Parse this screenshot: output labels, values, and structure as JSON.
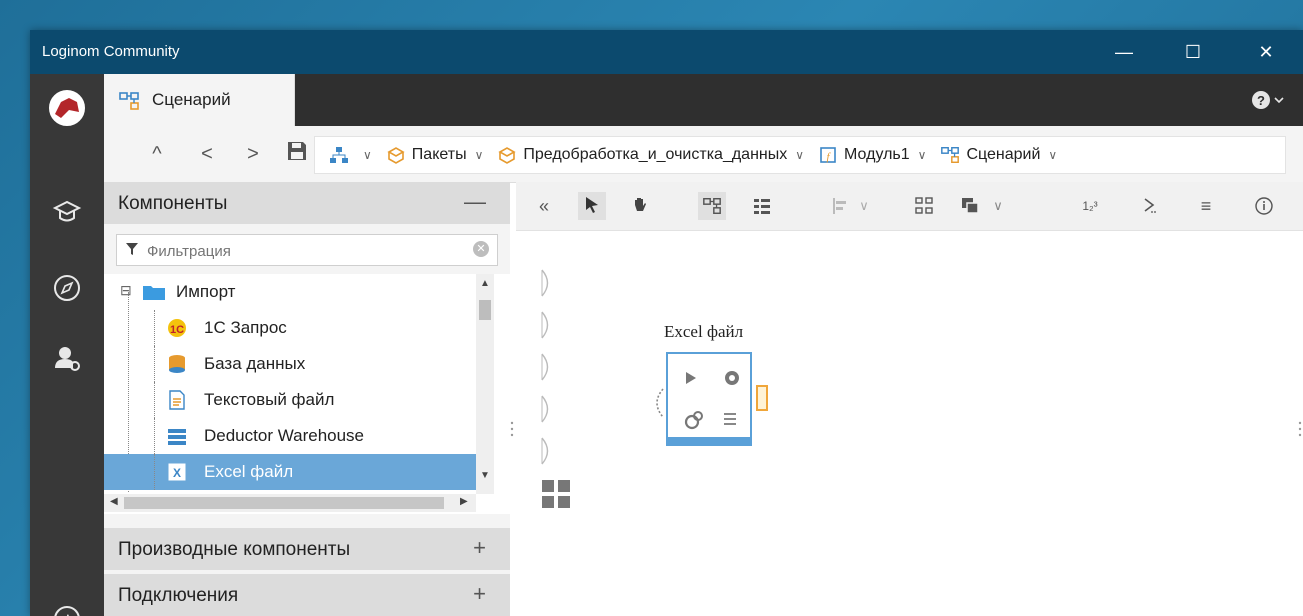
{
  "window": {
    "title": "Loginom Community",
    "controls": {
      "minimize": "—",
      "maximize": "☐",
      "close": "✕"
    }
  },
  "tabs": [
    {
      "label": "Сценарий",
      "icon": "scenario-icon",
      "active": true
    }
  ],
  "breadcrumbs": [
    {
      "label": "",
      "icon": "hierarchy-icon"
    },
    {
      "label": "Пакеты",
      "icon": "package-icon"
    },
    {
      "label": "Предобработка_и_очистка_данных",
      "icon": "package-icon"
    },
    {
      "label": "Модуль1",
      "icon": "module-icon"
    },
    {
      "label": "Сценарий",
      "icon": "scenario-icon"
    }
  ],
  "nav": {
    "up": "^",
    "back": "<",
    "forward": ">"
  },
  "components": {
    "header": "Компоненты",
    "collapse": "—",
    "filter_placeholder": "Фильтрация",
    "tree": [
      {
        "label": "Импорт",
        "icon": "folder-icon",
        "level": 0
      },
      {
        "label": "1С Запрос",
        "icon": "1c-icon",
        "level": 1
      },
      {
        "label": "База данных",
        "icon": "database-icon",
        "level": 1
      },
      {
        "label": "Текстовый файл",
        "icon": "text-file-icon",
        "level": 1
      },
      {
        "label": "Deductor Warehouse",
        "icon": "warehouse-icon",
        "level": 1
      },
      {
        "label": "Excel файл",
        "icon": "excel-icon",
        "level": 1,
        "selected": true
      }
    ]
  },
  "sections": [
    {
      "label": "Производные компоненты",
      "sign": "+"
    },
    {
      "label": "Подключения",
      "sign": "+"
    }
  ],
  "canvas": {
    "node": {
      "label": "Excel файл"
    }
  },
  "colors": {
    "titlebar": "#0c4a6e",
    "leftbar": "#383838",
    "selection": "#6aa7d8",
    "node_border": "#5aa0d8",
    "output_port": "#f0a63a"
  }
}
